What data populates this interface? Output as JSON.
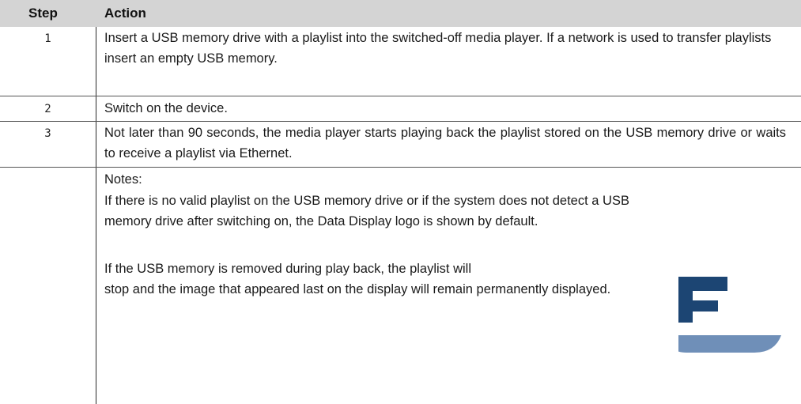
{
  "table": {
    "headers": {
      "step": "Step",
      "action": "Action"
    },
    "rows": [
      {
        "step": "1",
        "action": "Insert a USB memory drive with a playlist into the switched-off media player. If a network is used to transfer playlists insert an empty USB memory."
      },
      {
        "step": "2",
        "action": "Switch on the device."
      },
      {
        "step": "3",
        "action": "Not later than 90 seconds, the media player starts playing back the playlist stored on the USB memory drive or waits to receive a playlist via Ethernet."
      }
    ],
    "notes": {
      "label": "Notes:",
      "paragraph_1": "If there is no valid playlist on the USB memory drive or if the system does not detect a USB memory drive after switching on, the Data Display logo is shown by default.",
      "paragraph_2": "If the USB memory is removed during play back, the playlist will stop and the image that appeared last on the display will remain permanently displayed."
    }
  },
  "logo": {
    "icon": "data-display-logo-icon",
    "colors": {
      "letter": "#1c4573",
      "base": "#6f8fb8"
    }
  }
}
